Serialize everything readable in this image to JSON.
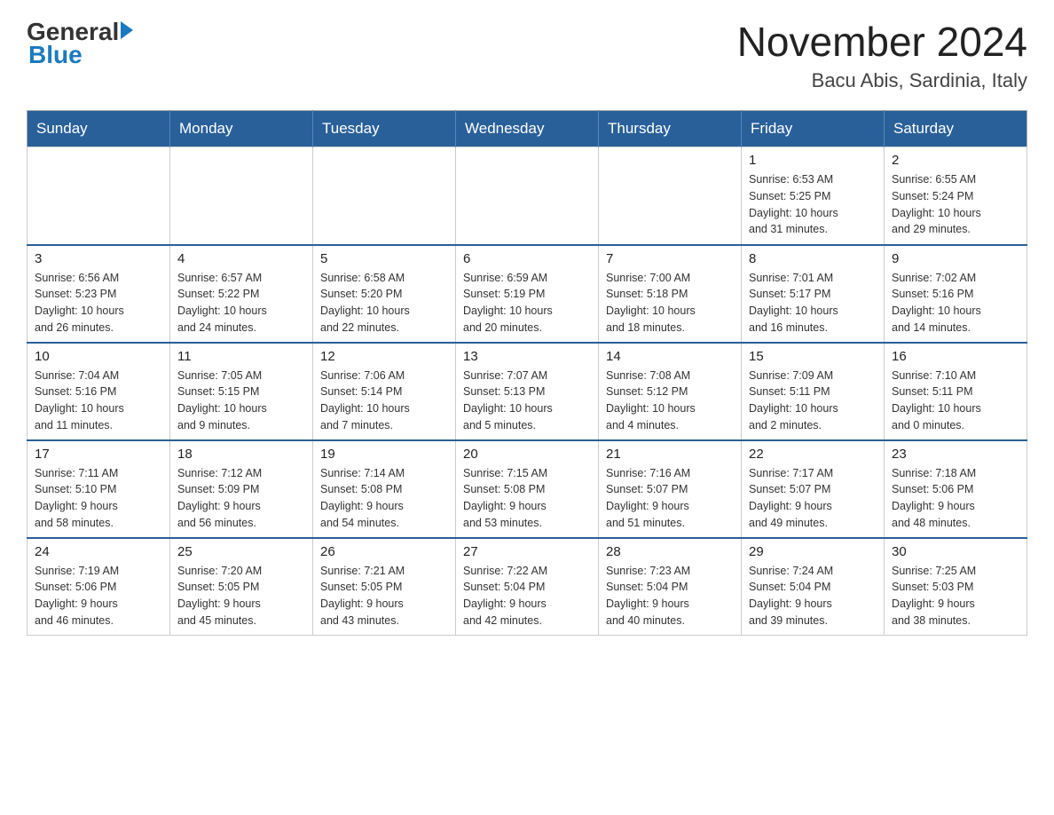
{
  "logo": {
    "general": "General",
    "blue": "Blue"
  },
  "title": {
    "month_year": "November 2024",
    "location": "Bacu Abis, Sardinia, Italy"
  },
  "days_of_week": [
    "Sunday",
    "Monday",
    "Tuesday",
    "Wednesday",
    "Thursday",
    "Friday",
    "Saturday"
  ],
  "weeks": [
    {
      "days": [
        {
          "number": "",
          "info": ""
        },
        {
          "number": "",
          "info": ""
        },
        {
          "number": "",
          "info": ""
        },
        {
          "number": "",
          "info": ""
        },
        {
          "number": "",
          "info": ""
        },
        {
          "number": "1",
          "info": "Sunrise: 6:53 AM\nSunset: 5:25 PM\nDaylight: 10 hours\nand 31 minutes."
        },
        {
          "number": "2",
          "info": "Sunrise: 6:55 AM\nSunset: 5:24 PM\nDaylight: 10 hours\nand 29 minutes."
        }
      ]
    },
    {
      "days": [
        {
          "number": "3",
          "info": "Sunrise: 6:56 AM\nSunset: 5:23 PM\nDaylight: 10 hours\nand 26 minutes."
        },
        {
          "number": "4",
          "info": "Sunrise: 6:57 AM\nSunset: 5:22 PM\nDaylight: 10 hours\nand 24 minutes."
        },
        {
          "number": "5",
          "info": "Sunrise: 6:58 AM\nSunset: 5:20 PM\nDaylight: 10 hours\nand 22 minutes."
        },
        {
          "number": "6",
          "info": "Sunrise: 6:59 AM\nSunset: 5:19 PM\nDaylight: 10 hours\nand 20 minutes."
        },
        {
          "number": "7",
          "info": "Sunrise: 7:00 AM\nSunset: 5:18 PM\nDaylight: 10 hours\nand 18 minutes."
        },
        {
          "number": "8",
          "info": "Sunrise: 7:01 AM\nSunset: 5:17 PM\nDaylight: 10 hours\nand 16 minutes."
        },
        {
          "number": "9",
          "info": "Sunrise: 7:02 AM\nSunset: 5:16 PM\nDaylight: 10 hours\nand 14 minutes."
        }
      ]
    },
    {
      "days": [
        {
          "number": "10",
          "info": "Sunrise: 7:04 AM\nSunset: 5:16 PM\nDaylight: 10 hours\nand 11 minutes."
        },
        {
          "number": "11",
          "info": "Sunrise: 7:05 AM\nSunset: 5:15 PM\nDaylight: 10 hours\nand 9 minutes."
        },
        {
          "number": "12",
          "info": "Sunrise: 7:06 AM\nSunset: 5:14 PM\nDaylight: 10 hours\nand 7 minutes."
        },
        {
          "number": "13",
          "info": "Sunrise: 7:07 AM\nSunset: 5:13 PM\nDaylight: 10 hours\nand 5 minutes."
        },
        {
          "number": "14",
          "info": "Sunrise: 7:08 AM\nSunset: 5:12 PM\nDaylight: 10 hours\nand 4 minutes."
        },
        {
          "number": "15",
          "info": "Sunrise: 7:09 AM\nSunset: 5:11 PM\nDaylight: 10 hours\nand 2 minutes."
        },
        {
          "number": "16",
          "info": "Sunrise: 7:10 AM\nSunset: 5:11 PM\nDaylight: 10 hours\nand 0 minutes."
        }
      ]
    },
    {
      "days": [
        {
          "number": "17",
          "info": "Sunrise: 7:11 AM\nSunset: 5:10 PM\nDaylight: 9 hours\nand 58 minutes."
        },
        {
          "number": "18",
          "info": "Sunrise: 7:12 AM\nSunset: 5:09 PM\nDaylight: 9 hours\nand 56 minutes."
        },
        {
          "number": "19",
          "info": "Sunrise: 7:14 AM\nSunset: 5:08 PM\nDaylight: 9 hours\nand 54 minutes."
        },
        {
          "number": "20",
          "info": "Sunrise: 7:15 AM\nSunset: 5:08 PM\nDaylight: 9 hours\nand 53 minutes."
        },
        {
          "number": "21",
          "info": "Sunrise: 7:16 AM\nSunset: 5:07 PM\nDaylight: 9 hours\nand 51 minutes."
        },
        {
          "number": "22",
          "info": "Sunrise: 7:17 AM\nSunset: 5:07 PM\nDaylight: 9 hours\nand 49 minutes."
        },
        {
          "number": "23",
          "info": "Sunrise: 7:18 AM\nSunset: 5:06 PM\nDaylight: 9 hours\nand 48 minutes."
        }
      ]
    },
    {
      "days": [
        {
          "number": "24",
          "info": "Sunrise: 7:19 AM\nSunset: 5:06 PM\nDaylight: 9 hours\nand 46 minutes."
        },
        {
          "number": "25",
          "info": "Sunrise: 7:20 AM\nSunset: 5:05 PM\nDaylight: 9 hours\nand 45 minutes."
        },
        {
          "number": "26",
          "info": "Sunrise: 7:21 AM\nSunset: 5:05 PM\nDaylight: 9 hours\nand 43 minutes."
        },
        {
          "number": "27",
          "info": "Sunrise: 7:22 AM\nSunset: 5:04 PM\nDaylight: 9 hours\nand 42 minutes."
        },
        {
          "number": "28",
          "info": "Sunrise: 7:23 AM\nSunset: 5:04 PM\nDaylight: 9 hours\nand 40 minutes."
        },
        {
          "number": "29",
          "info": "Sunrise: 7:24 AM\nSunset: 5:04 PM\nDaylight: 9 hours\nand 39 minutes."
        },
        {
          "number": "30",
          "info": "Sunrise: 7:25 AM\nSunset: 5:03 PM\nDaylight: 9 hours\nand 38 minutes."
        }
      ]
    }
  ]
}
